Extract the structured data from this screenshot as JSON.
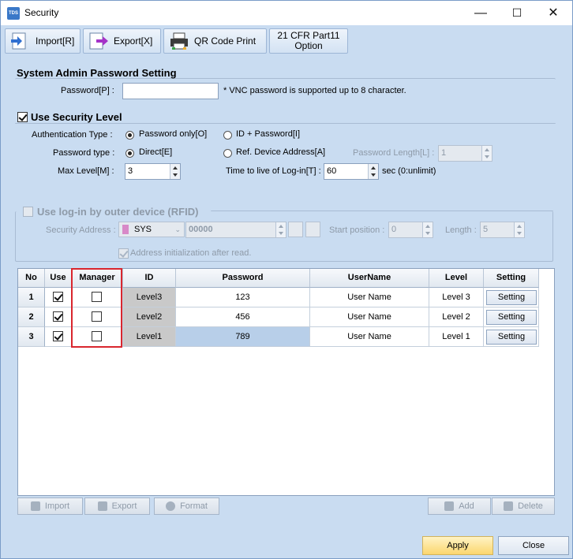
{
  "window": {
    "title": "Security",
    "app_icon_text": "TDS"
  },
  "toolbar": {
    "import_label": "Import[R]",
    "export_label": "Export[X]",
    "qr_label": "QR Code Print",
    "cfr_label_line1": "21 CFR Part11",
    "cfr_label_line2": "Option"
  },
  "admin": {
    "title": "System Admin Password Setting",
    "password_label": "Password[P] :",
    "password_value": "",
    "note": "* VNC password is supported up to 8 character."
  },
  "security_level": {
    "title": "Use Security Level",
    "checked": true,
    "auth_type_label": "Authentication Type :",
    "auth_option_1": "Password only[O]",
    "auth_option_2": "ID + Password[I]",
    "auth_selected": "Password only[O]",
    "password_type_label": "Password type :",
    "pw_type_option_1": "Direct[E]",
    "pw_type_option_2": "Ref. Device Address[A]",
    "pw_type_selected": "Direct[E]",
    "password_length_label": "Password Length[L] :",
    "password_length_value": "1",
    "max_level_label": "Max Level[M] :",
    "max_level_value": "3",
    "ttl_label": "Time to live of Log-in[T] :",
    "ttl_value": "60",
    "ttl_unit": "sec (0:unlimit)"
  },
  "rfid": {
    "title": "Use log-in by outer device (RFID)",
    "checked": false,
    "security_address_label": "Security Address :",
    "device_value": "SYS",
    "address_value": "00000",
    "start_position_label": "Start position :",
    "start_position_value": "0",
    "length_label": "Length :",
    "length_value": "5",
    "addr_init_label": "Address initialization after read.",
    "addr_init_checked": true
  },
  "grid": {
    "columns": [
      "No",
      "Use",
      "Manager",
      "ID",
      "Password",
      "UserName",
      "Level",
      "Setting"
    ],
    "rows": [
      {
        "no": "1",
        "use": true,
        "manager": false,
        "id": "Level3",
        "password": "123",
        "username": "User Name",
        "level": "Level 3",
        "setting": "Setting"
      },
      {
        "no": "2",
        "use": true,
        "manager": false,
        "id": "Level2",
        "password": "456",
        "username": "User Name",
        "level": "Level 2",
        "setting": "Setting"
      },
      {
        "no": "3",
        "use": true,
        "manager": false,
        "id": "Level1",
        "password": "789",
        "username": "User Name",
        "level": "Level 1",
        "setting": "Setting"
      }
    ]
  },
  "grid_actions": {
    "import_label": "Import",
    "export_label": "Export",
    "format_label": "Format",
    "add_label": "Add",
    "delete_label": "Delete"
  },
  "footer": {
    "apply_label": "Apply",
    "close_label": "Close"
  },
  "colors": {
    "window_bg": "#c9dcf1",
    "highlight": "#d9262e",
    "apply_bg": "#fbd66e",
    "selected_cell": "#b8cfe9"
  }
}
